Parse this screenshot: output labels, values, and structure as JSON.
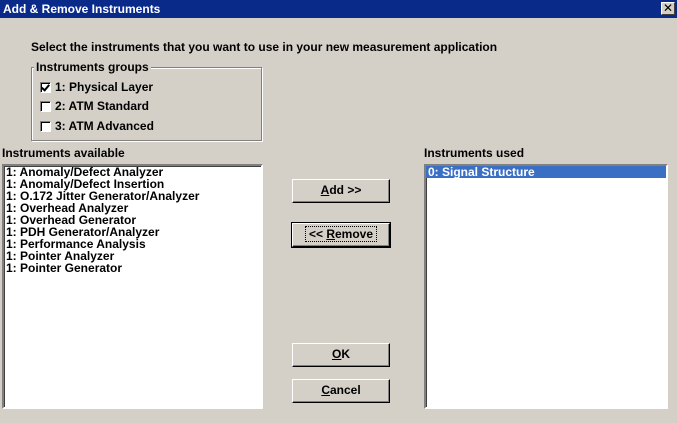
{
  "window": {
    "title": "Add & Remove Instruments",
    "close_glyph": "✕"
  },
  "instructions": "Select the instruments that you want to use in your new measurement application",
  "groups": {
    "legend": "Instruments groups",
    "items": [
      {
        "label": "1:  Physical Layer",
        "checked": true
      },
      {
        "label": "2:  ATM Standard",
        "checked": false
      },
      {
        "label": "3:  ATM Advanced",
        "checked": false
      }
    ]
  },
  "available": {
    "label": "Instruments available",
    "items": [
      "1: Anomaly/Defect Analyzer",
      "1: Anomaly/Defect Insertion",
      "1: O.172 Jitter Generator/Analyzer",
      "1: Overhead Analyzer",
      "1: Overhead Generator",
      "1: PDH Generator/Analyzer",
      "1: Performance Analysis",
      "1: Pointer Analyzer",
      "1: Pointer Generator"
    ]
  },
  "used": {
    "label": "Instruments used",
    "items": [
      "0: Signal Structure"
    ],
    "selected_index": 0
  },
  "buttons": {
    "add": "Add >>",
    "remove": "<< Remove",
    "ok": "OK",
    "cancel": "Cancel"
  }
}
